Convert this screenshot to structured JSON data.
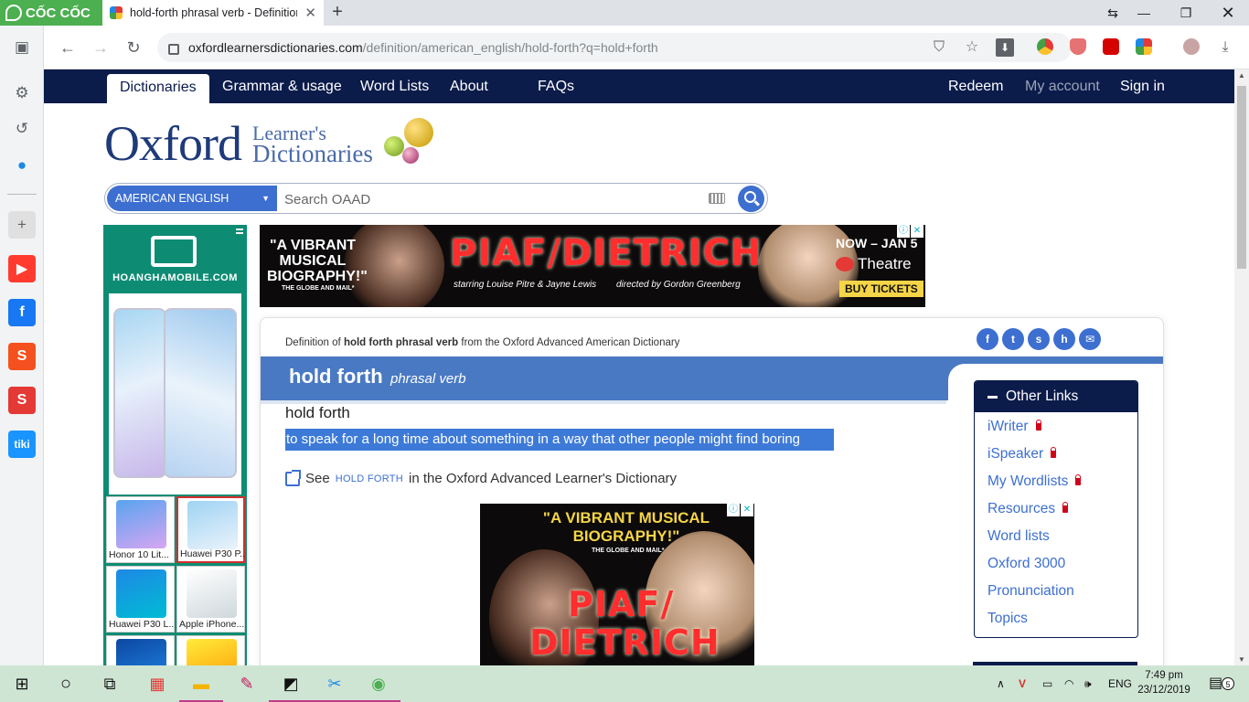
{
  "browser": {
    "brand": "CỐC CỐC",
    "tab_title": "hold-forth phrasal verb - Definition",
    "tab_close": "✕",
    "new_tab": "+",
    "url_host": "oxfordlearnersdictionaries.com",
    "url_path": "/definition/american_english/hold-forth?q=hold+forth"
  },
  "site_nav": {
    "left": [
      "Dictionaries",
      "Grammar & usage",
      "Word Lists",
      "About",
      "FAQs"
    ],
    "right": [
      "Redeem",
      "My account",
      "Sign in"
    ]
  },
  "logo": {
    "word": "Oxford",
    "line1": "Learner's",
    "line2": "Dictionaries"
  },
  "search": {
    "dictionary": "AMERICAN ENGLISH",
    "placeholder": "Search OAAD"
  },
  "left_ad": {
    "brand": "HOANGHAMOBILE.COM",
    "items": [
      "Honor 10 Lit...",
      "Huawei P30 P...",
      "Huawei P30 L...",
      "Apple iPhone..."
    ]
  },
  "banner_ad": {
    "quote": "\"A VIBRANT MUSICAL BIOGRAPHY!\"",
    "source": "THE GLOBE AND MAIL*",
    "show": "PIAF/DIETRICH",
    "starring": "starring Louise Pitre & Jayne Lewis",
    "director": "directed by Gordon Greenberg",
    "dates": "NOW – JAN 5",
    "venue": "Theatre",
    "cta": "BUY TICKETS"
  },
  "entry": {
    "source_prefix": "Definition of ",
    "source_bold": "hold forth phrasal verb",
    "source_suffix": " from the Oxford Advanced American Dictionary",
    "headword": "hold forth",
    "pos": "phrasal verb",
    "idiom": "hold forth",
    "definition": "to speak for a long time about something in a way that other people might find boring",
    "see_prefix": "See",
    "see_link": "HOLD FORTH",
    "see_suffix": "in the Oxford Advanced Learner's Dictionary"
  },
  "inner_ad": {
    "quote": "\"A VIBRANT MUSICAL BIOGRAPHY!\"",
    "source": "THE GLOBE AND MAIL*",
    "show_line1": "PIAF/",
    "show_line2": "DIETRICH"
  },
  "other_links": {
    "title": "Other Links",
    "items": [
      {
        "label": "iWriter",
        "locked": true
      },
      {
        "label": "iSpeaker",
        "locked": true
      },
      {
        "label": "My Wordlists",
        "locked": true
      },
      {
        "label": "Resources",
        "locked": true
      },
      {
        "label": "Word lists",
        "locked": false
      },
      {
        "label": "Oxford 3000",
        "locked": false
      },
      {
        "label": "Pronunciation",
        "locked": false
      },
      {
        "label": "Topics",
        "locked": false
      }
    ]
  },
  "taskbar": {
    "language": "ENG",
    "time": "7:49 pm",
    "date": "23/12/2019",
    "notifications": "5"
  },
  "colors": {
    "site_navy": "#0b1b4a",
    "site_blue": "#3d6fd1",
    "headband": "#4979c3",
    "selection": "#3d7ad8",
    "coccoc_green": "#4caf50"
  }
}
